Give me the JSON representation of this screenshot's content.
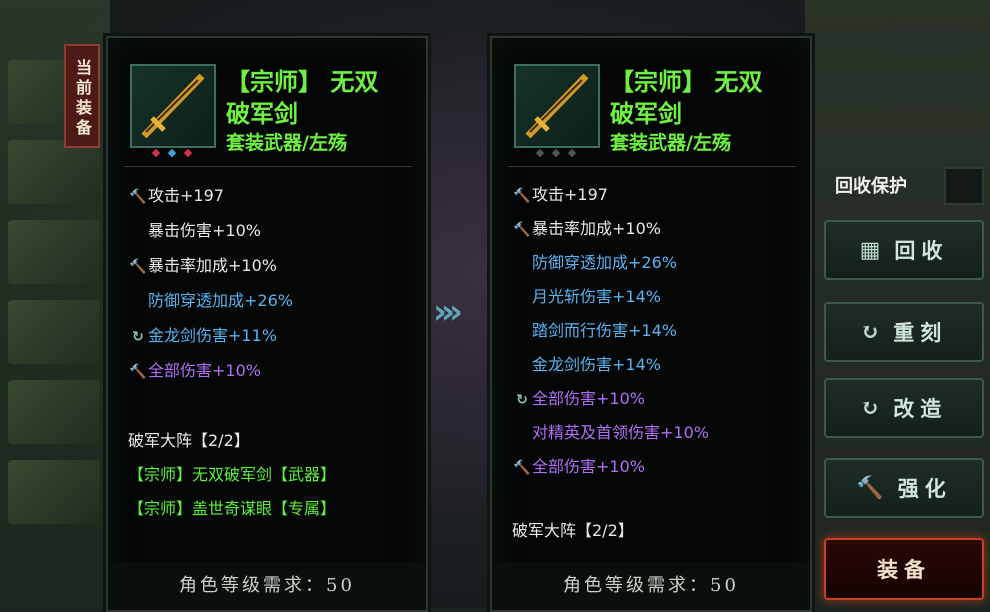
{
  "current_tag": "当前装备",
  "left": {
    "title_line1": "【宗师】 无双",
    "title_line2": "破军剑",
    "subtitle": "套装武器/左殇",
    "gems": [
      "◆",
      "◆",
      "◆"
    ],
    "stats": [
      {
        "icon": "hammer",
        "label": "攻击",
        "bonus": "+197",
        "color": "white"
      },
      {
        "icon": "",
        "label": "暴击伤害",
        "bonus": "+10%",
        "color": "white"
      },
      {
        "icon": "hammer",
        "label": "暴击率加成",
        "bonus": "+10%",
        "color": "white"
      },
      {
        "icon": "",
        "label": "防御穿透加成",
        "bonus": "+26%",
        "color": "blue"
      },
      {
        "icon": "refresh",
        "label": "金龙剑伤害",
        "bonus": "+11%",
        "color": "blue"
      },
      {
        "icon": "hammer",
        "label": "全部伤害",
        "bonus": "+10%",
        "color": "purple"
      }
    ],
    "set_name": "破军大阵【2/2】",
    "set_items": [
      "【宗师】无双破军剑【武器】",
      "【宗师】盖世奇谋眼【专属】"
    ],
    "requirement": "角色等级需求：50"
  },
  "right": {
    "title_line1": "【宗师】 无双",
    "title_line2": "破军剑",
    "subtitle": "套装武器/左殇",
    "gems": [
      "◆",
      "◆",
      "◆"
    ],
    "stats": [
      {
        "icon": "hammer",
        "label": "攻击",
        "bonus": "+197",
        "color": "white"
      },
      {
        "icon": "hammer",
        "label": "暴击率加成",
        "bonus": "+10%",
        "color": "white"
      },
      {
        "icon": "",
        "label": "防御穿透加成",
        "bonus": "+26%",
        "color": "blue"
      },
      {
        "icon": "",
        "label": "月光斩伤害",
        "bonus": "+14%",
        "color": "blue"
      },
      {
        "icon": "",
        "label": "踏剑而行伤害",
        "bonus": "+14%",
        "color": "blue"
      },
      {
        "icon": "",
        "label": "金龙剑伤害",
        "bonus": "+14%",
        "color": "blue"
      },
      {
        "icon": "refresh",
        "label": "全部伤害",
        "bonus": "+10%",
        "color": "purple"
      },
      {
        "icon": "",
        "label": "对精英及首领伤害",
        "bonus": "+10%",
        "color": "purple"
      },
      {
        "icon": "hammer",
        "label": "全部伤害",
        "bonus": "+10%",
        "color": "purple"
      }
    ],
    "set_name": "破军大阵【2/2】",
    "requirement": "角色等级需求：50"
  },
  "side": {
    "recycle_protect": "回收保护",
    "buttons": {
      "recycle": "回收",
      "reforge": "重刻",
      "modify": "改造",
      "enhance": "强化",
      "equip": "装备"
    }
  },
  "colors": {
    "title_green": "#6ff043",
    "stat_blue": "#5ab2f0",
    "stat_purple": "#b06ef5",
    "set_green": "#5df03d",
    "equip_border": "#c6411f"
  }
}
